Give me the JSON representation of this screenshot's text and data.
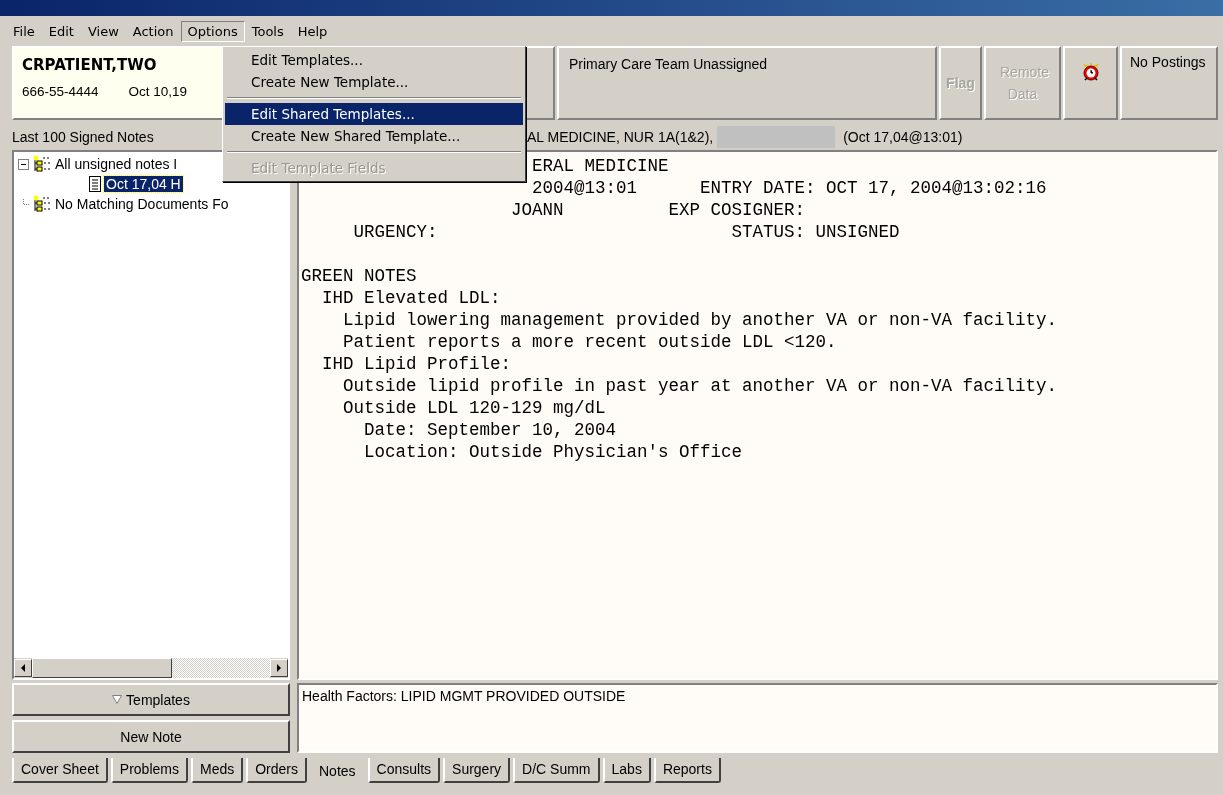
{
  "menu_bar": [
    {
      "label": "File",
      "selected": false
    },
    {
      "label": "Edit",
      "selected": false
    },
    {
      "label": "View",
      "selected": false
    },
    {
      "label": "Action",
      "selected": false
    },
    {
      "label": "Options",
      "selected": true
    },
    {
      "label": "Tools",
      "selected": false
    },
    {
      "label": "Help",
      "selected": false
    }
  ],
  "options_menu": [
    {
      "kind": "item",
      "label": "Edit Templates...",
      "selected": false,
      "disabled": false
    },
    {
      "kind": "item",
      "label": "Create New Template...",
      "selected": false,
      "disabled": false
    },
    {
      "kind": "separator"
    },
    {
      "kind": "item",
      "label": "Edit Shared Templates...",
      "selected": true,
      "disabled": false
    },
    {
      "kind": "item",
      "label": "Create New Shared Template...",
      "selected": false,
      "disabled": false
    },
    {
      "kind": "separator"
    },
    {
      "kind": "item",
      "label": "Edit Template Fields",
      "selected": false,
      "disabled": true
    }
  ],
  "patient": {
    "name": "CRPATIENT,TWO",
    "ssn": "666-55-4444",
    "dob": "Oct 10,19"
  },
  "care_team": "Primary Care Team Unassigned",
  "flag_button": {
    "label": "Flag",
    "disabled": true
  },
  "remote_data_button": {
    "label": "Remote Data",
    "disabled": true
  },
  "postings": "No Postings",
  "notes_list": {
    "title": "Last 100 Signed Notes",
    "tree": [
      {
        "label": "All unsigned notes I",
        "expanded": true,
        "children": [
          {
            "label": "Oct 17,04  H",
            "selected": true
          }
        ]
      },
      {
        "label": "No Matching Documents Fo"
      }
    ]
  },
  "note": {
    "title": "AL MEDICINE, NUR 1A(1&2),",
    "title_date": "(Oct 17,04@13:01)",
    "lines": [
      "ERAL MEDICINE",
      "2004@13:01      ENTRY DATE: OCT 17, 2004@13:02:16",
      "JOANN          EXP COSIGNER:",
      "URGENCY:                            STATUS: UNSIGNED",
      "GREEN NOTES",
      "IHD Elevated LDL:",
      "Lipid lowering management provided by another VA or non-VA facility.",
      "Patient reports a more recent outside LDL <120.",
      "IHD Lipid Profile:",
      "Outside lipid profile in past year at another VA or non-VA facility.",
      "Outside LDL 120-129 mg/dL",
      "Date: September 10, 2004",
      "Location: Outside Physician's Office"
    ]
  },
  "templates_button": "Templates",
  "new_note_button": "New Note",
  "health_factors": "Health Factors: LIPID MGMT PROVIDED OUTSIDE",
  "tabs": [
    {
      "label": "Cover Sheet",
      "selected": false
    },
    {
      "label": "Problems",
      "selected": false
    },
    {
      "label": "Meds",
      "selected": false
    },
    {
      "label": "Orders",
      "selected": false
    },
    {
      "label": "Notes",
      "selected": true
    },
    {
      "label": "Consults",
      "selected": false
    },
    {
      "label": "Surgery",
      "selected": false
    },
    {
      "label": "D/C Summ",
      "selected": false
    },
    {
      "label": "Labs",
      "selected": false
    },
    {
      "label": "Reports",
      "selected": false
    }
  ]
}
